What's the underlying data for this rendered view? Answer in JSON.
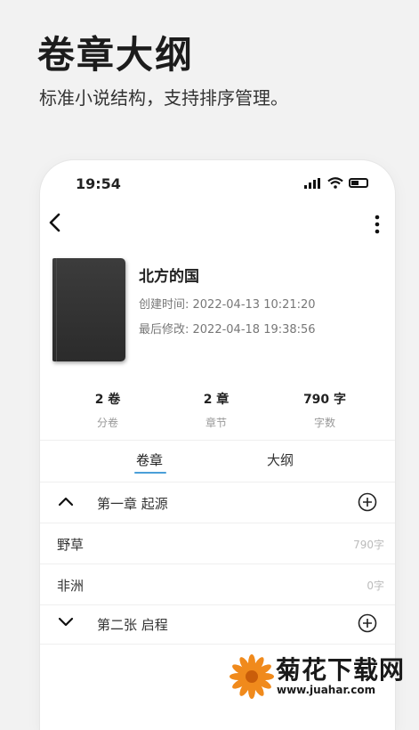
{
  "promo": {
    "headline": "卷章大纲",
    "subline": "标准小说结构，支持排序管理。"
  },
  "status_bar": {
    "time": "19:54"
  },
  "book": {
    "title": "北方的国",
    "created": "创建时间: 2022-04-13 10:21:20",
    "modified": "最后修改: 2022-04-18 19:38:56"
  },
  "stats": [
    {
      "value": "2 卷",
      "label": "分卷"
    },
    {
      "value": "2 章",
      "label": "章节"
    },
    {
      "value": "790 字",
      "label": "字数"
    }
  ],
  "tabs": [
    {
      "label": "卷章",
      "active": true
    },
    {
      "label": "大纲",
      "active": false
    }
  ],
  "volumes": [
    {
      "title": "第一章 起源",
      "expanded": true,
      "chapters": [
        {
          "title": "野草",
          "count": "790字"
        },
        {
          "title": "非洲",
          "count": "0字"
        }
      ]
    },
    {
      "title": "第二张 启程",
      "expanded": false,
      "chapters": []
    }
  ],
  "watermark": {
    "name": "菊花下载网",
    "url": "www.juahar.com"
  },
  "colors": {
    "accent": "#4a9fd8",
    "logo": "#f08a1c"
  }
}
